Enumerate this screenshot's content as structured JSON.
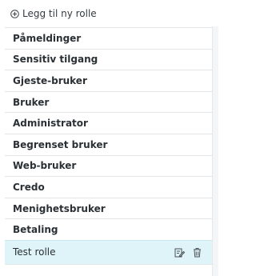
{
  "add_role": {
    "label": "Legg til ny rolle",
    "icon": "plus-circle-icon"
  },
  "roles": [
    {
      "label": "Påmeldinger"
    },
    {
      "label": "Sensitiv tilgang"
    },
    {
      "label": "Gjeste-bruker"
    },
    {
      "label": "Bruker"
    },
    {
      "label": "Administrator"
    },
    {
      "label": "Begrenset bruker"
    },
    {
      "label": "Web-bruker"
    },
    {
      "label": "Credo"
    },
    {
      "label": "Menighetsbruker"
    },
    {
      "label": "Betaling"
    },
    {
      "label": "Test rolle",
      "selected": true,
      "actions": [
        "edit-icon",
        "trash-icon"
      ]
    }
  ],
  "colors": {
    "selected_bg": "#def4f8",
    "text": "#2b3035",
    "divider": "#e3e6e8"
  }
}
